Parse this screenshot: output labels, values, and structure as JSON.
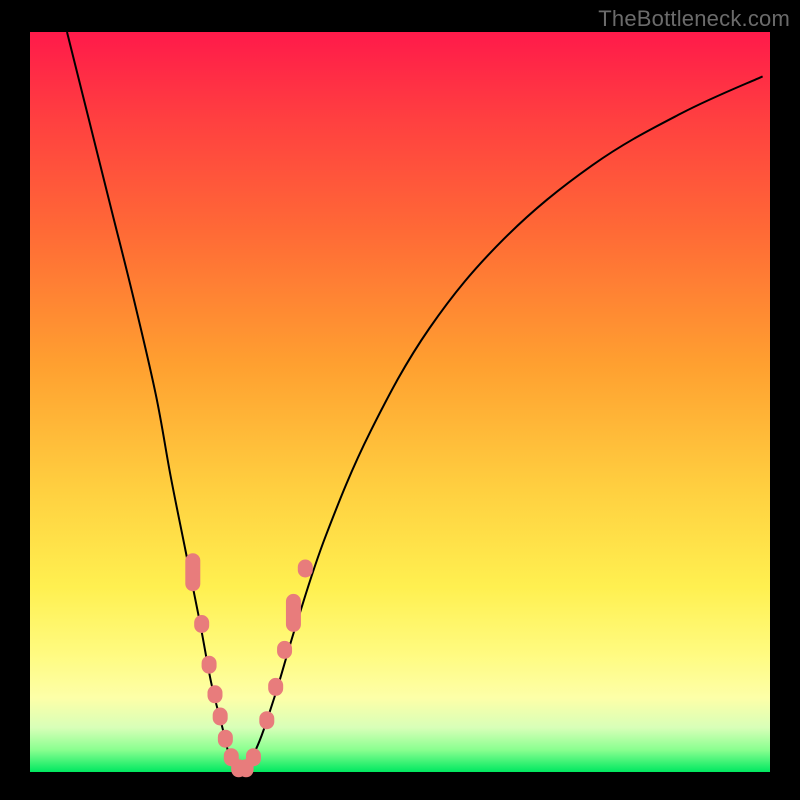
{
  "watermark": "TheBottleneck.com",
  "chart_data": {
    "type": "line",
    "title": "",
    "xlabel": "",
    "ylabel": "",
    "xlim": [
      0,
      100
    ],
    "ylim": [
      0,
      100
    ],
    "background_gradient": {
      "top": "#ff1a4a",
      "middle": "#ffd040",
      "bottom": "#00e860"
    },
    "series": [
      {
        "name": "bottleneck-curve",
        "color": "#000000",
        "x": [
          5,
          8,
          11,
          14,
          17,
          19,
          21,
          23,
          24.5,
          26,
          27,
          28,
          28.5,
          30.5,
          33,
          36,
          40,
          46,
          54,
          64,
          76,
          88,
          99
        ],
        "y": [
          100,
          88,
          76,
          64,
          51,
          40,
          30,
          20,
          12,
          6,
          2,
          0.5,
          0.5,
          3,
          10,
          20,
          32,
          46,
          60,
          72,
          82,
          89,
          94
        ]
      }
    ],
    "markers": {
      "name": "highlighted-points",
      "color": "#e87c7c",
      "shape": "rounded-rect",
      "points": [
        {
          "x": 22.0,
          "y": 27.0,
          "long": true
        },
        {
          "x": 23.2,
          "y": 20.0
        },
        {
          "x": 24.2,
          "y": 14.5
        },
        {
          "x": 25.0,
          "y": 10.5
        },
        {
          "x": 25.7,
          "y": 7.5
        },
        {
          "x": 26.4,
          "y": 4.5
        },
        {
          "x": 27.2,
          "y": 2.0
        },
        {
          "x": 28.2,
          "y": 0.5
        },
        {
          "x": 29.2,
          "y": 0.5
        },
        {
          "x": 30.2,
          "y": 2.0
        },
        {
          "x": 32.0,
          "y": 7.0
        },
        {
          "x": 33.2,
          "y": 11.5
        },
        {
          "x": 34.4,
          "y": 16.5
        },
        {
          "x": 35.6,
          "y": 21.5,
          "long": true
        },
        {
          "x": 37.2,
          "y": 27.5
        }
      ]
    }
  }
}
